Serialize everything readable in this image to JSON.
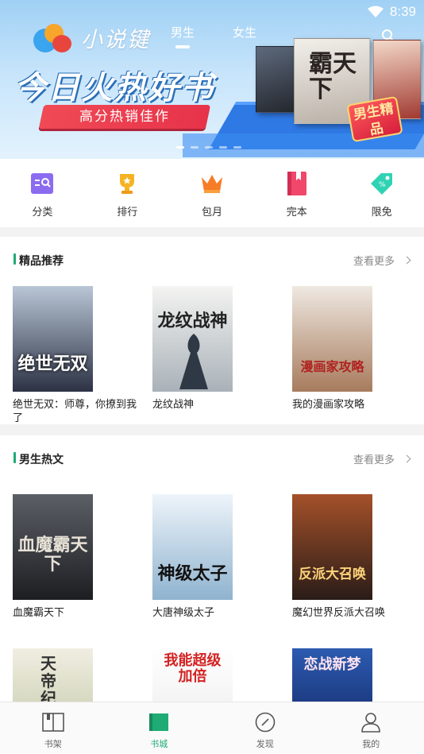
{
  "status_bar": {
    "time": "8:39"
  },
  "banner": {
    "logo_text": "小说键",
    "tabs": [
      {
        "label": "男生",
        "active": true
      },
      {
        "label": "女生",
        "active": false
      }
    ],
    "headline": "今日火热好书",
    "subline": "高分热销佳作",
    "book_title_big": "霸天下",
    "tag": "男生精品",
    "slide_count": 5,
    "active_slide": 0
  },
  "categories": [
    {
      "label": "分类",
      "icon": "category-icon",
      "color": "#8b6cf0"
    },
    {
      "label": "排行",
      "icon": "trophy-icon",
      "color": "#f5b324"
    },
    {
      "label": "包月",
      "icon": "crown-icon",
      "color": "#f77c26"
    },
    {
      "label": "完本",
      "icon": "book-bookmark-icon",
      "color": "#f0476a"
    },
    {
      "label": "限免",
      "icon": "discount-tag-icon",
      "color": "#2fd3b4"
    }
  ],
  "sections": [
    {
      "title": "精品推荐",
      "more": "查看更多",
      "books": [
        {
          "title": "绝世无双：师尊，你撩到我了",
          "cover_text": "绝世无双",
          "cover_colors": [
            "#b9c6d6",
            "#2c3244"
          ]
        },
        {
          "title": "龙纹战神",
          "cover_text": "龙纹战神",
          "cover_colors": [
            "#f4f4f2",
            "#a9b1b8"
          ]
        },
        {
          "title": "我的漫画家攻略",
          "cover_text": "漫画家攻略",
          "cover_colors": [
            "#efe9e2",
            "#a77b5d"
          ]
        }
      ]
    },
    {
      "title": "男生热文",
      "more": "查看更多",
      "books": [
        {
          "title": "血魔霸天下",
          "cover_text": "血魔霸天下",
          "cover_colors": [
            "#5b5f66",
            "#1d1e22"
          ]
        },
        {
          "title": "大唐神级太子",
          "cover_text": "神级太子",
          "cover_colors": [
            "#eef4fa",
            "#8fb3cf"
          ]
        },
        {
          "title": "魔幻世界反派大召唤",
          "cover_text": "反派大召唤",
          "cover_colors": [
            "#a4512a",
            "#2a1c18"
          ]
        }
      ]
    },
    {
      "title": "",
      "more": "",
      "books": [
        {
          "title": "",
          "cover_text": "天帝纪",
          "cover_colors": [
            "#f1eee2",
            "#bcc4a0"
          ]
        },
        {
          "title": "",
          "cover_text": "我能超级加倍",
          "cover_colors": [
            "#ffffff",
            "#e9e9e9"
          ]
        },
        {
          "title": "",
          "cover_text": "恋战新梦",
          "cover_colors": [
            "#2c5bb0",
            "#0f1f5a"
          ]
        }
      ]
    }
  ],
  "bottom_nav": [
    {
      "label": "书架",
      "icon": "bookshelf-icon",
      "active": false
    },
    {
      "label": "书城",
      "icon": "bookstore-icon",
      "active": true
    },
    {
      "label": "发现",
      "icon": "compass-icon",
      "active": false
    },
    {
      "label": "我的",
      "icon": "profile-icon",
      "active": false
    }
  ],
  "colors": {
    "accent": "#1fab74",
    "banner_sky": "#9fd0f4"
  }
}
